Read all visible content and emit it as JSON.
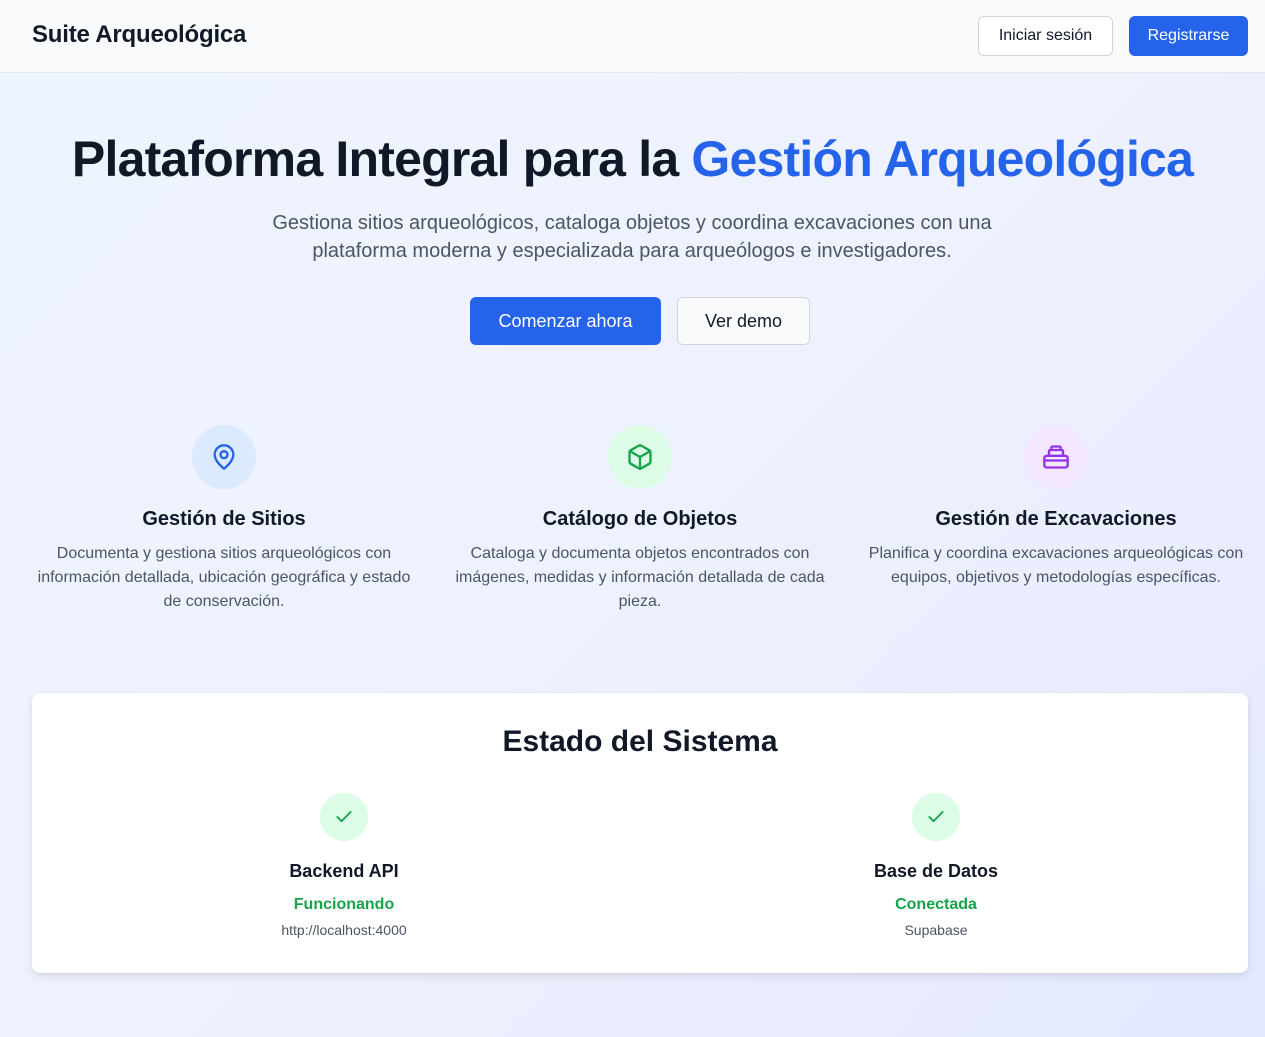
{
  "header": {
    "brand": "Suite Arqueológica",
    "login_label": "Iniciar sesión",
    "register_label": "Registrarse"
  },
  "hero": {
    "title_main": "Plataforma Integral para la ",
    "title_accent": "Gestión Arqueológica",
    "subtitle": "Gestiona sitios arqueológicos, cataloga objetos y coordina excavaciones con una plataforma moderna y especializada para arqueólogos e investigadores.",
    "primary_cta": "Comenzar ahora",
    "secondary_cta": "Ver demo"
  },
  "features": [
    {
      "icon": "map-pin-icon",
      "title": "Gestión de Sitios",
      "description": "Documenta y gestiona sitios arqueológicos con información detallada, ubicación geográfica y estado de conservación.",
      "icon_color": "#2563eb",
      "icon_bg": "#dbeafe"
    },
    {
      "icon": "box-icon",
      "title": "Catálogo de Objetos",
      "description": "Cataloga y documenta objetos encontrados con imágenes, medidas y información detallada de cada pieza.",
      "icon_color": "#16a34a",
      "icon_bg": "#dcfce7"
    },
    {
      "icon": "archive-icon",
      "title": "Gestión de Excavaciones",
      "description": "Planifica y coordina excavaciones arqueológicas con equipos, objetivos y metodologías específicas.",
      "icon_color": "#9333ea",
      "icon_bg": "#f3e8ff"
    }
  ],
  "system_status": {
    "title": "Estado del Sistema",
    "items": [
      {
        "icon": "check-icon",
        "name": "Backend API",
        "state": "Funcionando",
        "detail": "http://localhost:4000"
      },
      {
        "icon": "check-icon",
        "name": "Base de Datos",
        "state": "Conectada",
        "detail": "Supabase"
      }
    ]
  },
  "colors": {
    "primary": "#2563eb",
    "success": "#16a34a",
    "text": "#111827",
    "muted": "#4b5563"
  }
}
